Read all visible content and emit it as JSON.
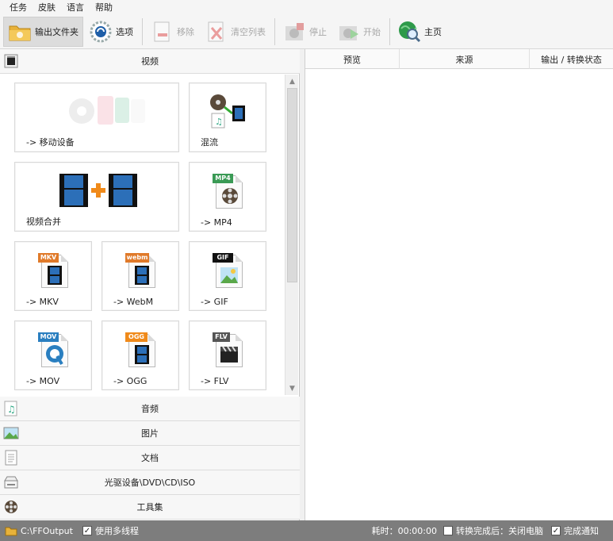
{
  "menu": [
    "任务",
    "皮肤",
    "语言",
    "帮助"
  ],
  "toolbar": {
    "output_folder": "输出文件夹",
    "options": "选项",
    "remove": "移除",
    "clear_list": "清空列表",
    "stop": "停止",
    "start": "开始",
    "home": "主页"
  },
  "categories": {
    "video": "视频",
    "audio": "音频",
    "picture": "图片",
    "document": "文档",
    "rom": "光驱设备\\DVD\\CD\\ISO",
    "tools": "工具集"
  },
  "tiles": [
    {
      "label": "-> 移动设备"
    },
    {
      "label": "混流"
    },
    {
      "label": "视频合并"
    },
    {
      "label": "-> MP4",
      "badge": "MP4",
      "badge_color": "#3a9a55"
    },
    {
      "label": "-> MKV",
      "badge": "MKV",
      "badge_color": "#e07a2a"
    },
    {
      "label": "-> WebM",
      "badge": "webm",
      "badge_color": "#e07a2a"
    },
    {
      "label": "-> GIF",
      "badge": "GIF",
      "badge_color": "#111111"
    },
    {
      "label": "-> MOV",
      "badge": "MOV",
      "badge_color": "#2a7fc0"
    },
    {
      "label": "-> OGG",
      "badge": "OGG",
      "badge_color": "#f08a1a"
    },
    {
      "label": "-> FLV",
      "badge": "FLV",
      "badge_color": "#555555"
    }
  ],
  "table": {
    "columns": [
      "预览",
      "来源",
      "输出 / 转换状态"
    ]
  },
  "status": {
    "output_path": "C:\\FFOutput",
    "multithread": "使用多线程",
    "elapsed": "耗时：00:00:00",
    "after_convert": "转换完成后：关闭电脑",
    "notify": "完成通知"
  }
}
